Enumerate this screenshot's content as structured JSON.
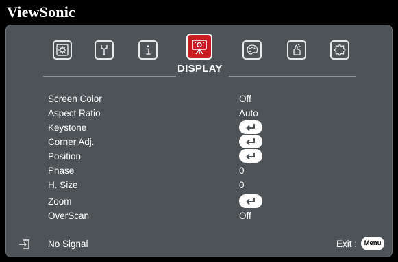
{
  "brand": "ViewSonic",
  "tabs": [
    {
      "icon": "image-settings-icon",
      "active": false
    },
    {
      "icon": "wrench-icon",
      "active": false
    },
    {
      "icon": "information-icon",
      "active": false
    },
    {
      "icon": "display-icon",
      "active": true
    },
    {
      "icon": "color-palette-icon",
      "active": false
    },
    {
      "icon": "hand-pointer-icon",
      "active": false
    },
    {
      "icon": "advanced-gear-icon",
      "active": false
    }
  ],
  "active_tab_title": "DISPLAY",
  "menu": [
    {
      "label": "Screen Color",
      "value": "Off"
    },
    {
      "label": "Aspect Ratio",
      "value": "Auto"
    },
    {
      "label": "Keystone",
      "value": "",
      "enter": true
    },
    {
      "label": "Corner Adj.",
      "value": "",
      "enter": true
    },
    {
      "label": "Position",
      "value": "",
      "enter": true
    },
    {
      "label": "Phase",
      "value": "0"
    },
    {
      "label": "H. Size",
      "value": "0"
    },
    {
      "label": "Zoom",
      "value": "",
      "enter": true
    },
    {
      "label": "OverScan",
      "value": "Off"
    }
  ],
  "footer": {
    "source_icon": "input-source-icon",
    "status": "No Signal",
    "exit_label": "Exit :",
    "menu_button": "Menu"
  },
  "colors": {
    "panel": "#4e5357",
    "active_tab": "#c71c22",
    "text": "#ffffff",
    "background": "#000000"
  }
}
